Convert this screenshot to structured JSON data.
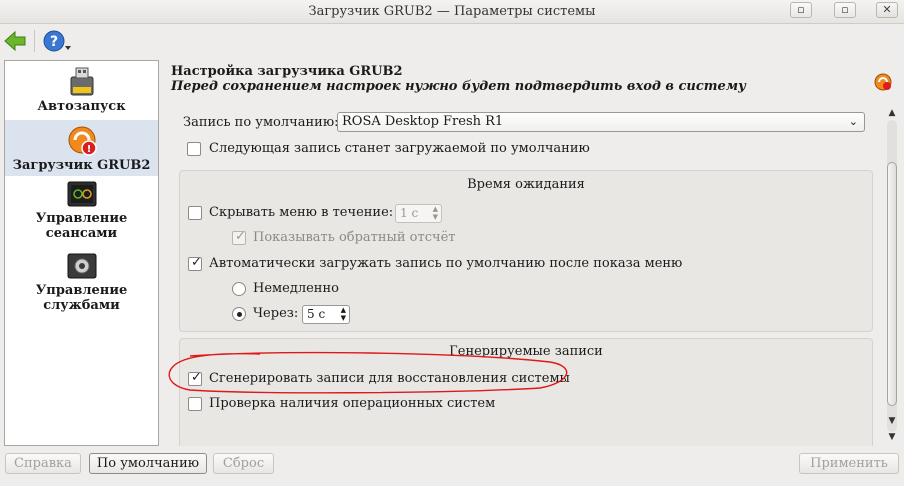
{
  "window": {
    "title": "Загрузчик GRUB2 — Параметры системы",
    "buttons": [
      "□",
      "□",
      "✕"
    ]
  },
  "sidebar": {
    "items": [
      {
        "label": "Автозапуск",
        "icon": "usb-drive-icon"
      },
      {
        "label": "Загрузчик GRUB2",
        "icon": "grub-bootloader-icon",
        "active": true
      },
      {
        "label": "Управление сеансами",
        "icon": "power-session-icon"
      },
      {
        "label": "Управление службами",
        "icon": "services-gear-icon"
      }
    ]
  },
  "header": {
    "title": "Настройка загрузчика GRUB2",
    "subtitle": "Перед сохранением настроек нужно будет подтвердить вход в систему"
  },
  "default_entry": {
    "label": "Запись по умолчанию:",
    "value": "ROSA Desktop Fresh R1",
    "next_checkbox": "Следующая запись станет загружаемой по умолчанию"
  },
  "timeout": {
    "title": "Время ожидания",
    "hide_menu_label": "Скрывать меню в течение:",
    "hide_menu_value": "1 с",
    "show_countdown_label": "Показывать обратный отсчёт",
    "auto_boot_label": "Автоматически загружать запись по умолчанию после показа меню",
    "immediately_label": "Немедленно",
    "after_label": "Через:",
    "after_value": "5 с"
  },
  "generated": {
    "title": "Генерируемые записи",
    "recovery_label": "Сгенерировать записи для восстановления системы",
    "os_prober_label": "Проверка наличия операционных систем"
  },
  "buttons": {
    "help": "Справка",
    "defaults": "По умолчанию",
    "reset": "Сброс",
    "apply": "Применить"
  },
  "colors": {
    "annotation": "#e01818",
    "sidebar_active": "#dbe4ee"
  }
}
